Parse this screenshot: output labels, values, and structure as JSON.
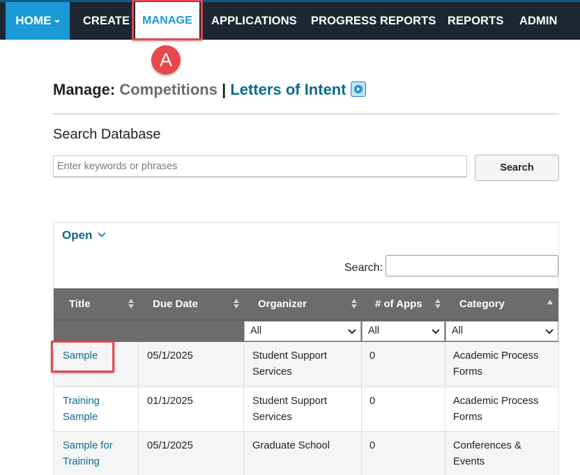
{
  "nav": {
    "items": [
      "HOME",
      "CREATE",
      "MANAGE",
      "APPLICATIONS",
      "PROGRESS REPORTS",
      "REPORTS",
      "ADMIN"
    ],
    "active": "MANAGE"
  },
  "annotation": {
    "label": "A",
    "color": "#e8474c"
  },
  "heading": {
    "prefix": "Manage:",
    "competitions": "Competitions",
    "separator": "|",
    "letters_of_intent": "Letters of Intent"
  },
  "search_db": {
    "title": "Search Database",
    "placeholder": "Enter keywords or phrases",
    "button": "Search"
  },
  "panel": {
    "toggle_label": "Open",
    "search_label": "Search:"
  },
  "table": {
    "columns": [
      "Title",
      "Due Date",
      "Organizer",
      "# of Apps",
      "Category"
    ],
    "filters": [
      "All",
      "All",
      "All"
    ],
    "rows": [
      {
        "title": "Sample",
        "due": "05/1/2025",
        "organizer": "Student Support Services",
        "apps": "0",
        "category": "Academic Process Forms"
      },
      {
        "title": "Training Sample",
        "due": "01/1/2025",
        "organizer": "Student Support Services",
        "apps": "0",
        "category": "Academic Process Forms"
      },
      {
        "title": "Sample for Training",
        "due": "05/1/2025",
        "organizer": "Graduate School",
        "apps": "0",
        "category": "Conferences & Events"
      }
    ]
  },
  "colors": {
    "nav_bg": "#1d2733",
    "home_bg": "#1a9ad6",
    "link": "#0b6b8c",
    "header_bg": "#6c6c6c",
    "highlight": "#e8474c"
  }
}
